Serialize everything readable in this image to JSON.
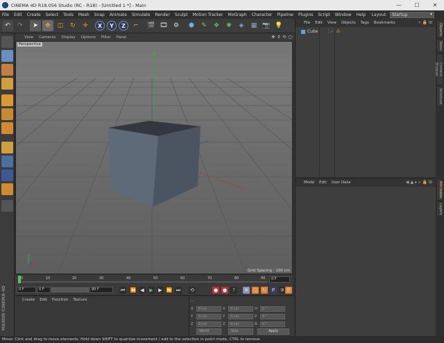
{
  "window": {
    "title": "CINEMA 4D R18.056 Studio (RC - R18) - [Untitled 1 *] - Main",
    "minimize": "—",
    "maximize": "☐",
    "close": "✕"
  },
  "menubar": {
    "items": [
      "File",
      "Edit",
      "Create",
      "Select",
      "Tools",
      "Mesh",
      "Snap",
      "Animate",
      "Simulate",
      "Render",
      "Sculpt",
      "Motion Tracker",
      "MoGraph",
      "Character",
      "Pipeline",
      "Plugins",
      "Script",
      "Window",
      "Help"
    ],
    "layout_label": "Layout:",
    "layout_value": "Startup"
  },
  "toolbar": {
    "axis_x": "X",
    "axis_y": "Y",
    "axis_z": "Z"
  },
  "viewport": {
    "menu": [
      "View",
      "Cameras",
      "Display",
      "Options",
      "Filter",
      "Panel"
    ],
    "camera_label": "Perspective",
    "grid_spacing": "Grid Spacing : 100 cm"
  },
  "timeline": {
    "ticks": [
      "0",
      "10",
      "20",
      "30",
      "40",
      "50",
      "60",
      "70",
      "80",
      "90"
    ],
    "current_frame_display": "0 F"
  },
  "transport": {
    "start": "0 F",
    "current": "0 F",
    "preview_end": "90 F",
    "end": "90 F"
  },
  "material_manager": {
    "menu": [
      "Create",
      "Edit",
      "Function",
      "Texture"
    ],
    "brand": "MAXON CINEMA 4D"
  },
  "coordinates": {
    "dashes": "---",
    "rows": [
      {
        "l1": "X",
        "v1": "0 cm",
        "l2": "X",
        "v2": "0 cm",
        "l3": "H",
        "v3": "0 °"
      },
      {
        "l1": "Y",
        "v1": "0 cm",
        "l2": "Y",
        "v2": "0 cm",
        "l3": "P",
        "v3": "0 °"
      },
      {
        "l1": "Z",
        "v1": "0 cm",
        "l2": "Z",
        "v2": "0 cm",
        "l3": "B",
        "v3": "0 °"
      }
    ],
    "mode_dropdown": "World",
    "size_dropdown": "Size",
    "apply": "Apply"
  },
  "object_manager": {
    "menu": [
      "File",
      "Edit",
      "View",
      "Objects",
      "Tags",
      "Bookmarks"
    ],
    "objects": [
      {
        "name": "Cube"
      }
    ]
  },
  "attribute_manager": {
    "menu": [
      "Mode",
      "Edit",
      "User Data"
    ]
  },
  "right_tabs": {
    "top": [
      "Objects",
      "Takes",
      "Content Browser",
      "Structure"
    ],
    "bottom": [
      "Attributes",
      "Layers"
    ]
  },
  "status": {
    "text": "Move: Click and drag to move elements. Hold down SHIFT to quantize movement / add to the selection in point mode, CTRL to remove."
  }
}
